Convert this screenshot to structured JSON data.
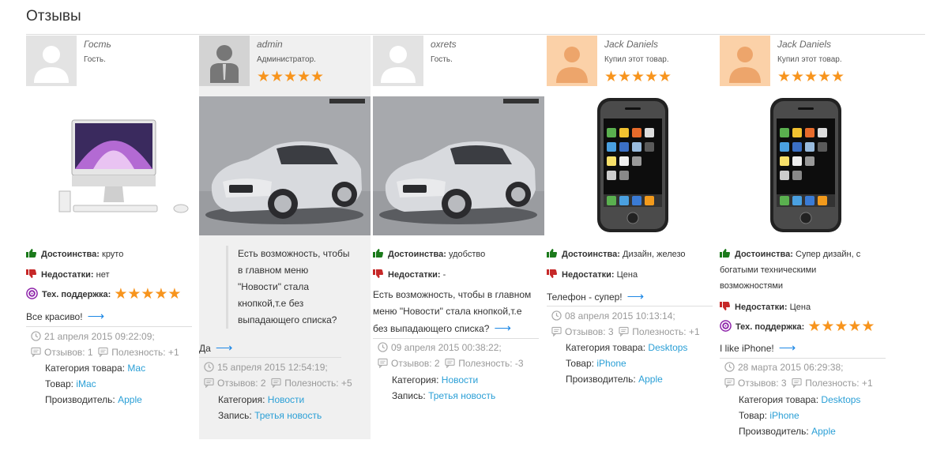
{
  "page": {
    "title": "Отзывы"
  },
  "reviews": [
    {
      "author": "Гость",
      "role": "Гость.",
      "pros_label": "Достоинства:",
      "pros": "круто",
      "cons_label": "Недостатки:",
      "cons": "нет",
      "support_label": "Тех. поддержка:",
      "support_rating": 5,
      "text": "Все красиво!",
      "date": "21 апреля 2015 09:22:09;",
      "reviews_count": "Отзывов: 1",
      "usefulness": "Полезность: +1",
      "category_label": "Категория товара:",
      "category": "Mac",
      "product_label": "Товар:",
      "product": "iMac",
      "maker_label": "Производитель:",
      "maker": "Apple"
    },
    {
      "author": "admin",
      "role": "Администратор.",
      "rating": 5,
      "quote": [
        "Есть возможность, чтобы",
        "в главном меню",
        " \"Новости\" стала",
        "кнопкой,т.е без",
        "выпадающего списка?"
      ],
      "text": "Да",
      "date": "15 апреля 2015 12:54:19;",
      "reviews_count": "Отзывов: 2",
      "usefulness": "Полезность: +5",
      "category_label": "Категория:",
      "category": "Новости",
      "post_label": "Запись:",
      "post": "Третья новость"
    },
    {
      "author": "oxrets",
      "role": "Гость.",
      "pros_label": "Достоинства:",
      "pros": "удобство",
      "cons_label": "Недостатки:",
      "cons": "-",
      "text_lines": [
        "Есть возможность, чтобы в главном",
        "меню  \"Новости\" стала кнопкой,т.е",
        "без выпадающего списка?"
      ],
      "date": "09 апреля 2015 00:38:22;",
      "reviews_count": "Отзывов: 2",
      "usefulness": "Полезность: -3",
      "category_label": "Категория:",
      "category": "Новости",
      "post_label": "Запись:",
      "post": "Третья новость"
    },
    {
      "author": "Jack Daniels",
      "role": "Купил этот товар.",
      "rating": 5,
      "pros_label": "Достоинства:",
      "pros": "Дизайн, железо",
      "cons_label": "Недостатки:",
      "cons": "Цена",
      "text": "Телефон - супер!",
      "date": "08 апреля 2015 10:13:14;",
      "reviews_count": "Отзывов: 3",
      "usefulness": "Полезность: +1",
      "category_label": "Категория товара:",
      "category": "Desktops",
      "product_label": "Товар:",
      "product": "iPhone",
      "maker_label": "Производитель:",
      "maker": "Apple"
    },
    {
      "author": "Jack Daniels",
      "role": "Купил этот товар.",
      "rating": 5,
      "pros_label": "Достоинства:",
      "pros_lines": [
        "Супер дизайн, с",
        "богатыми техническими",
        "возможностями"
      ],
      "cons_label": "Недостатки:",
      "cons": "Цена",
      "support_label": "Тех. поддержка:",
      "support_rating": 5,
      "text": "I like iPhone!",
      "date": "28 марта 2015 06:29:38;",
      "reviews_count": "Отзывов: 3",
      "usefulness": "Полезность: +1",
      "category_label": "Категория товара:",
      "category": "Desktops",
      "product_label": "Товар:",
      "product": "iPhone",
      "maker_label": "Производитель:",
      "maker": "Apple"
    }
  ],
  "icons": {
    "star": "★",
    "arrow": "⟶",
    "pros_icon": "thumbs-up-icon",
    "cons_icon": "thumbs-down-icon",
    "support_icon": "support-lifebuoy-icon",
    "date_icon": "clock-icon",
    "comment_icon": "comment-icon"
  },
  "colors": {
    "accent_star": "#f7941d",
    "link": "#2a9fd6",
    "pros": "#1b7a1b",
    "cons": "#c62828",
    "support": "#8e24aa",
    "arrow": "#1e88e5"
  }
}
